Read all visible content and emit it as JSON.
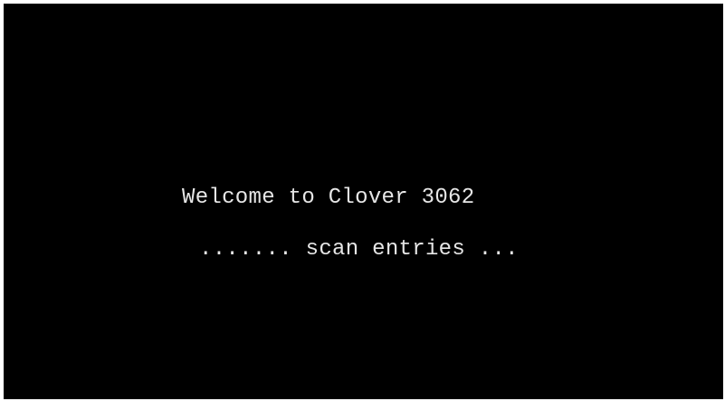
{
  "boot_screen": {
    "welcome_text": "Welcome to Clover 3062",
    "status_text": "....... scan entries ...",
    "background_color": "#000000",
    "text_color": "#e6e6e6"
  }
}
